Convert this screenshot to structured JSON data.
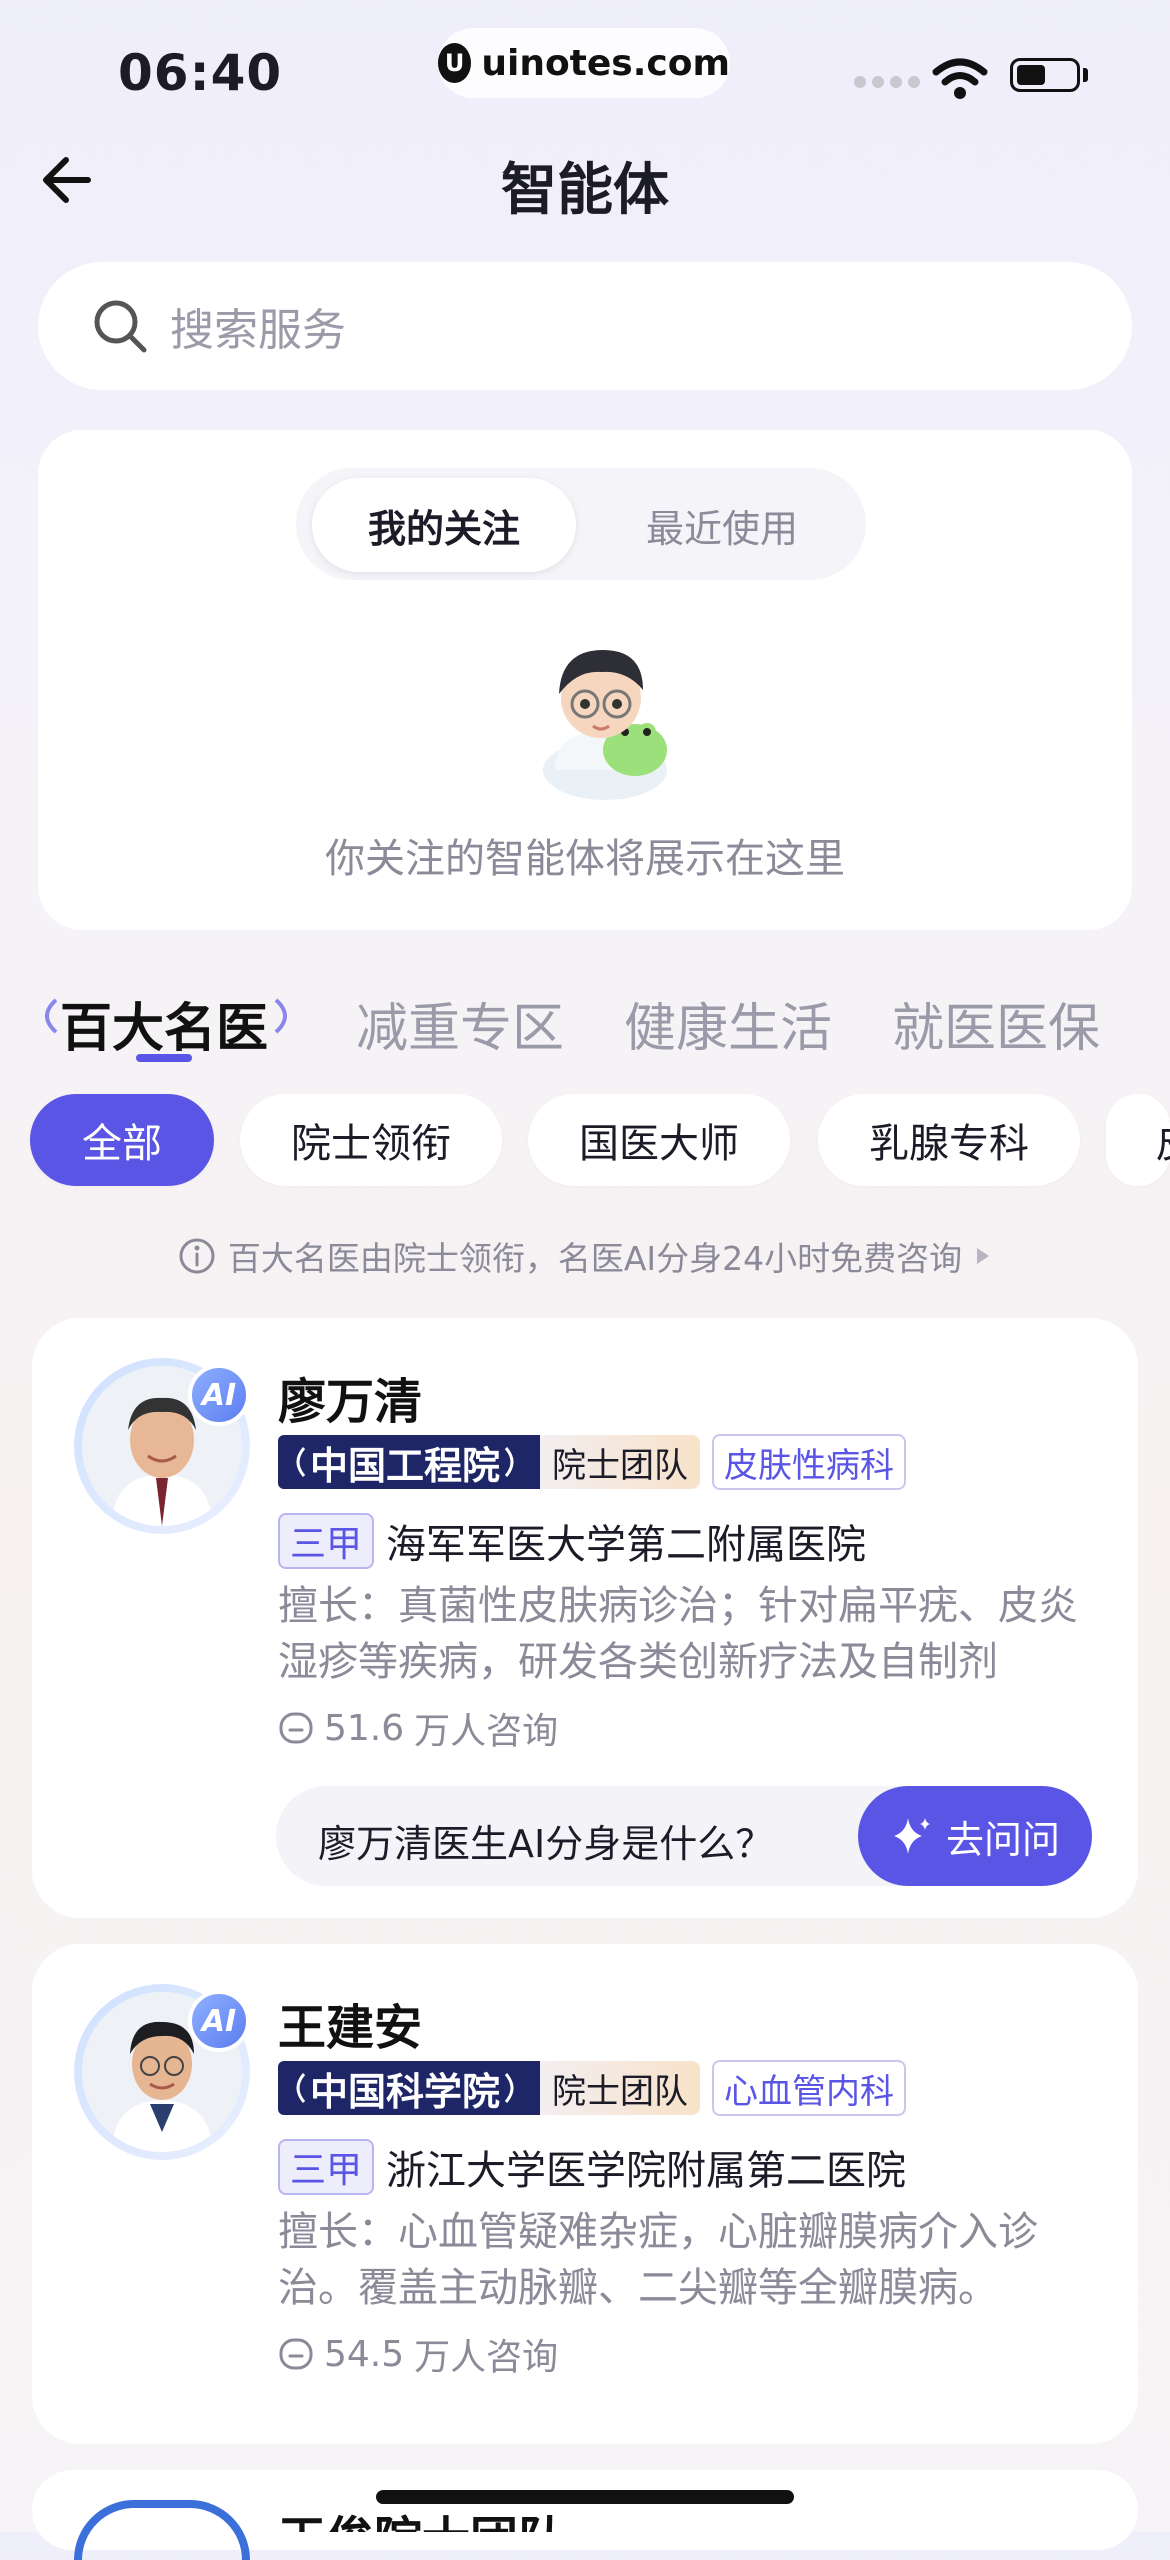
{
  "status_bar": {
    "time": "06:40",
    "url": "uinotes.com"
  },
  "header": {
    "title": "智能体"
  },
  "search": {
    "placeholder": "搜索服务"
  },
  "follow": {
    "tabs": [
      {
        "label": "我的关注",
        "active": true
      },
      {
        "label": "最近使用",
        "active": false
      }
    ],
    "empty_text": "你关注的智能体将展示在这里"
  },
  "categories": [
    "百大名医",
    "减重专区",
    "健康生活",
    "就医医保"
  ],
  "chips": [
    "全部",
    "院士领衔",
    "国医大师",
    "乳腺专科",
    "皮"
  ],
  "info_text": "百大名医由院士领衔，名医AI分身24小时免费咨询",
  "doctors": [
    {
      "name": "廖万清",
      "org": "中国工程院",
      "team": "院士团队",
      "dept": "皮肤性病科",
      "level": "三甲",
      "hospital": "海军军医大学第二附属医院",
      "desc_line1": "擅长：真菌性皮肤病诊治；针对扁平疣、皮炎",
      "desc_line2": "湿疹等疾病，研发各类创新疗法及自制剂",
      "consult_count": "51.6",
      "consult_unit": "万人咨询",
      "ask_text": "廖万清医生AI分身是什么？",
      "ask_button": "去问问"
    },
    {
      "name": "王建安",
      "org": "中国科学院",
      "team": "院士团队",
      "dept": "心血管内科",
      "level": "三甲",
      "hospital": "浙江大学医学院附属第二医院",
      "desc_line1": "擅长：心血管疑难杂症，心脏瓣膜病介入诊",
      "desc_line2": "治。覆盖主动脉瓣、二尖瓣等全瓣膜病。",
      "consult_count": "54.5",
      "consult_unit": "万人咨询"
    },
    {
      "name": "王俊院士团队"
    }
  ],
  "ai_badge": "AI",
  "colors": {
    "accent": "#5b55e6",
    "org_tag_bg": "#1e2668"
  }
}
